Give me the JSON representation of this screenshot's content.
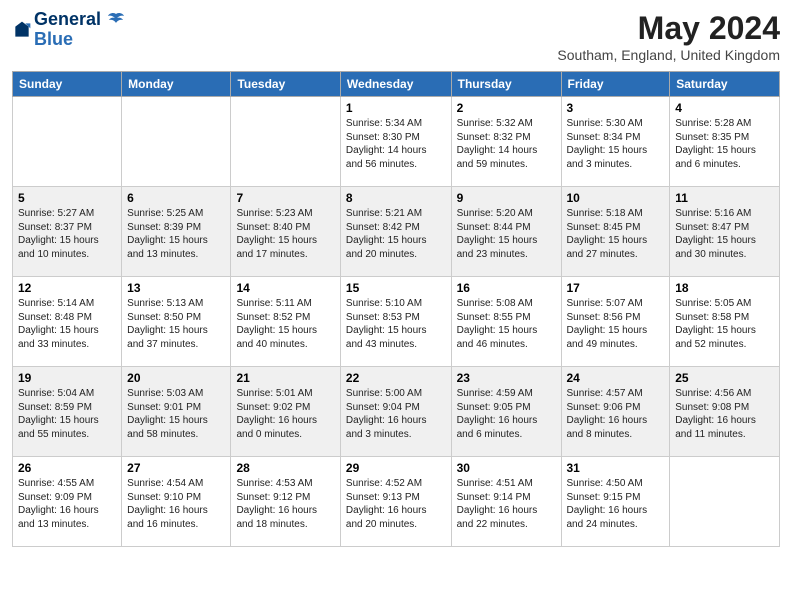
{
  "header": {
    "logo_line1": "General",
    "logo_line2": "Blue",
    "month_title": "May 2024",
    "location": "Southam, England, United Kingdom"
  },
  "days_of_week": [
    "Sunday",
    "Monday",
    "Tuesday",
    "Wednesday",
    "Thursday",
    "Friday",
    "Saturday"
  ],
  "weeks": [
    {
      "shaded": false,
      "days": [
        {
          "num": "",
          "info": ""
        },
        {
          "num": "",
          "info": ""
        },
        {
          "num": "",
          "info": ""
        },
        {
          "num": "1",
          "info": "Sunrise: 5:34 AM\nSunset: 8:30 PM\nDaylight: 14 hours\nand 56 minutes."
        },
        {
          "num": "2",
          "info": "Sunrise: 5:32 AM\nSunset: 8:32 PM\nDaylight: 14 hours\nand 59 minutes."
        },
        {
          "num": "3",
          "info": "Sunrise: 5:30 AM\nSunset: 8:34 PM\nDaylight: 15 hours\nand 3 minutes."
        },
        {
          "num": "4",
          "info": "Sunrise: 5:28 AM\nSunset: 8:35 PM\nDaylight: 15 hours\nand 6 minutes."
        }
      ]
    },
    {
      "shaded": true,
      "days": [
        {
          "num": "5",
          "info": "Sunrise: 5:27 AM\nSunset: 8:37 PM\nDaylight: 15 hours\nand 10 minutes."
        },
        {
          "num": "6",
          "info": "Sunrise: 5:25 AM\nSunset: 8:39 PM\nDaylight: 15 hours\nand 13 minutes."
        },
        {
          "num": "7",
          "info": "Sunrise: 5:23 AM\nSunset: 8:40 PM\nDaylight: 15 hours\nand 17 minutes."
        },
        {
          "num": "8",
          "info": "Sunrise: 5:21 AM\nSunset: 8:42 PM\nDaylight: 15 hours\nand 20 minutes."
        },
        {
          "num": "9",
          "info": "Sunrise: 5:20 AM\nSunset: 8:44 PM\nDaylight: 15 hours\nand 23 minutes."
        },
        {
          "num": "10",
          "info": "Sunrise: 5:18 AM\nSunset: 8:45 PM\nDaylight: 15 hours\nand 27 minutes."
        },
        {
          "num": "11",
          "info": "Sunrise: 5:16 AM\nSunset: 8:47 PM\nDaylight: 15 hours\nand 30 minutes."
        }
      ]
    },
    {
      "shaded": false,
      "days": [
        {
          "num": "12",
          "info": "Sunrise: 5:14 AM\nSunset: 8:48 PM\nDaylight: 15 hours\nand 33 minutes."
        },
        {
          "num": "13",
          "info": "Sunrise: 5:13 AM\nSunset: 8:50 PM\nDaylight: 15 hours\nand 37 minutes."
        },
        {
          "num": "14",
          "info": "Sunrise: 5:11 AM\nSunset: 8:52 PM\nDaylight: 15 hours\nand 40 minutes."
        },
        {
          "num": "15",
          "info": "Sunrise: 5:10 AM\nSunset: 8:53 PM\nDaylight: 15 hours\nand 43 minutes."
        },
        {
          "num": "16",
          "info": "Sunrise: 5:08 AM\nSunset: 8:55 PM\nDaylight: 15 hours\nand 46 minutes."
        },
        {
          "num": "17",
          "info": "Sunrise: 5:07 AM\nSunset: 8:56 PM\nDaylight: 15 hours\nand 49 minutes."
        },
        {
          "num": "18",
          "info": "Sunrise: 5:05 AM\nSunset: 8:58 PM\nDaylight: 15 hours\nand 52 minutes."
        }
      ]
    },
    {
      "shaded": true,
      "days": [
        {
          "num": "19",
          "info": "Sunrise: 5:04 AM\nSunset: 8:59 PM\nDaylight: 15 hours\nand 55 minutes."
        },
        {
          "num": "20",
          "info": "Sunrise: 5:03 AM\nSunset: 9:01 PM\nDaylight: 15 hours\nand 58 minutes."
        },
        {
          "num": "21",
          "info": "Sunrise: 5:01 AM\nSunset: 9:02 PM\nDaylight: 16 hours\nand 0 minutes."
        },
        {
          "num": "22",
          "info": "Sunrise: 5:00 AM\nSunset: 9:04 PM\nDaylight: 16 hours\nand 3 minutes."
        },
        {
          "num": "23",
          "info": "Sunrise: 4:59 AM\nSunset: 9:05 PM\nDaylight: 16 hours\nand 6 minutes."
        },
        {
          "num": "24",
          "info": "Sunrise: 4:57 AM\nSunset: 9:06 PM\nDaylight: 16 hours\nand 8 minutes."
        },
        {
          "num": "25",
          "info": "Sunrise: 4:56 AM\nSunset: 9:08 PM\nDaylight: 16 hours\nand 11 minutes."
        }
      ]
    },
    {
      "shaded": false,
      "days": [
        {
          "num": "26",
          "info": "Sunrise: 4:55 AM\nSunset: 9:09 PM\nDaylight: 16 hours\nand 13 minutes."
        },
        {
          "num": "27",
          "info": "Sunrise: 4:54 AM\nSunset: 9:10 PM\nDaylight: 16 hours\nand 16 minutes."
        },
        {
          "num": "28",
          "info": "Sunrise: 4:53 AM\nSunset: 9:12 PM\nDaylight: 16 hours\nand 18 minutes."
        },
        {
          "num": "29",
          "info": "Sunrise: 4:52 AM\nSunset: 9:13 PM\nDaylight: 16 hours\nand 20 minutes."
        },
        {
          "num": "30",
          "info": "Sunrise: 4:51 AM\nSunset: 9:14 PM\nDaylight: 16 hours\nand 22 minutes."
        },
        {
          "num": "31",
          "info": "Sunrise: 4:50 AM\nSunset: 9:15 PM\nDaylight: 16 hours\nand 24 minutes."
        },
        {
          "num": "",
          "info": ""
        }
      ]
    }
  ]
}
